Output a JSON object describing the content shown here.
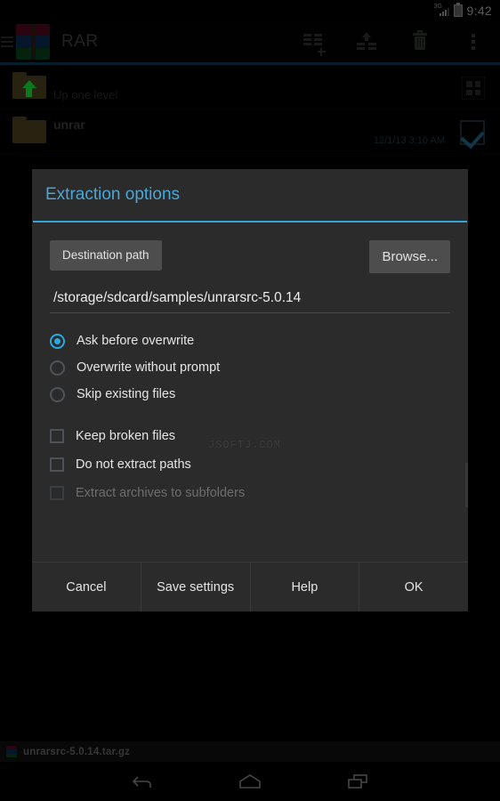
{
  "status_bar": {
    "network_label": "3G",
    "time": "9:42",
    "signal_icon": "signal-bars-icon",
    "battery_icon": "battery-icon"
  },
  "action_bar": {
    "app_title": "RAR",
    "app_icon": "rar-archive-icon",
    "menu_icon": "hamburger-menu-icon",
    "actions": [
      {
        "name": "add-to-archive",
        "icon": "add-to-archive-icon"
      },
      {
        "name": "extract",
        "icon": "extract-icon"
      },
      {
        "name": "delete",
        "icon": "trash-icon"
      },
      {
        "name": "overflow",
        "icon": "overflow-menu-icon"
      }
    ],
    "divider_color": "#33a5d4"
  },
  "file_list": {
    "rows": [
      {
        "name": "Up one level",
        "icon": "folder-up-icon",
        "date": "",
        "trailing_icon": "select-all-grid-icon",
        "checked": false
      },
      {
        "name": "unrar",
        "icon": "folder-icon",
        "date": "12/1/13 3:10 AM",
        "trailing_icon": "checkbox-checked-icon",
        "checked": true
      }
    ]
  },
  "dialog": {
    "title": "Extraction options",
    "destination_label": "Destination path",
    "browse_label": "Browse...",
    "path_value": "/storage/sdcard/samples/unrarsrc-5.0.14",
    "path_placeholder": "Destination path",
    "overwrite_options": [
      {
        "label": "Ask before overwrite",
        "selected": true,
        "disabled": false
      },
      {
        "label": "Overwrite without prompt",
        "selected": false,
        "disabled": false
      },
      {
        "label": "Skip existing files",
        "selected": false,
        "disabled": false
      }
    ],
    "checkboxes": [
      {
        "label": "Keep broken files",
        "checked": false,
        "disabled": false
      },
      {
        "label": "Do not extract paths",
        "checked": false,
        "disabled": false
      },
      {
        "label": "Extract archives to subfolders",
        "checked": false,
        "disabled": true
      }
    ],
    "watermark": "JSOFTJ.COM",
    "buttons": [
      {
        "label": "Cancel",
        "name": "cancel-button"
      },
      {
        "label": "Save settings",
        "name": "save-settings-button"
      },
      {
        "label": "Help",
        "name": "help-button"
      },
      {
        "label": "OK",
        "name": "ok-button"
      }
    ],
    "accent_color": "#33a5d4"
  },
  "bottom_bar": {
    "archive_name": "unrarsrc-5.0.14.tar.gz",
    "archive_icon": "rar-archive-icon"
  },
  "nav_bar": {
    "back_icon": "back-arrow-icon",
    "home_icon": "home-icon",
    "recents_icon": "recents-icon"
  }
}
